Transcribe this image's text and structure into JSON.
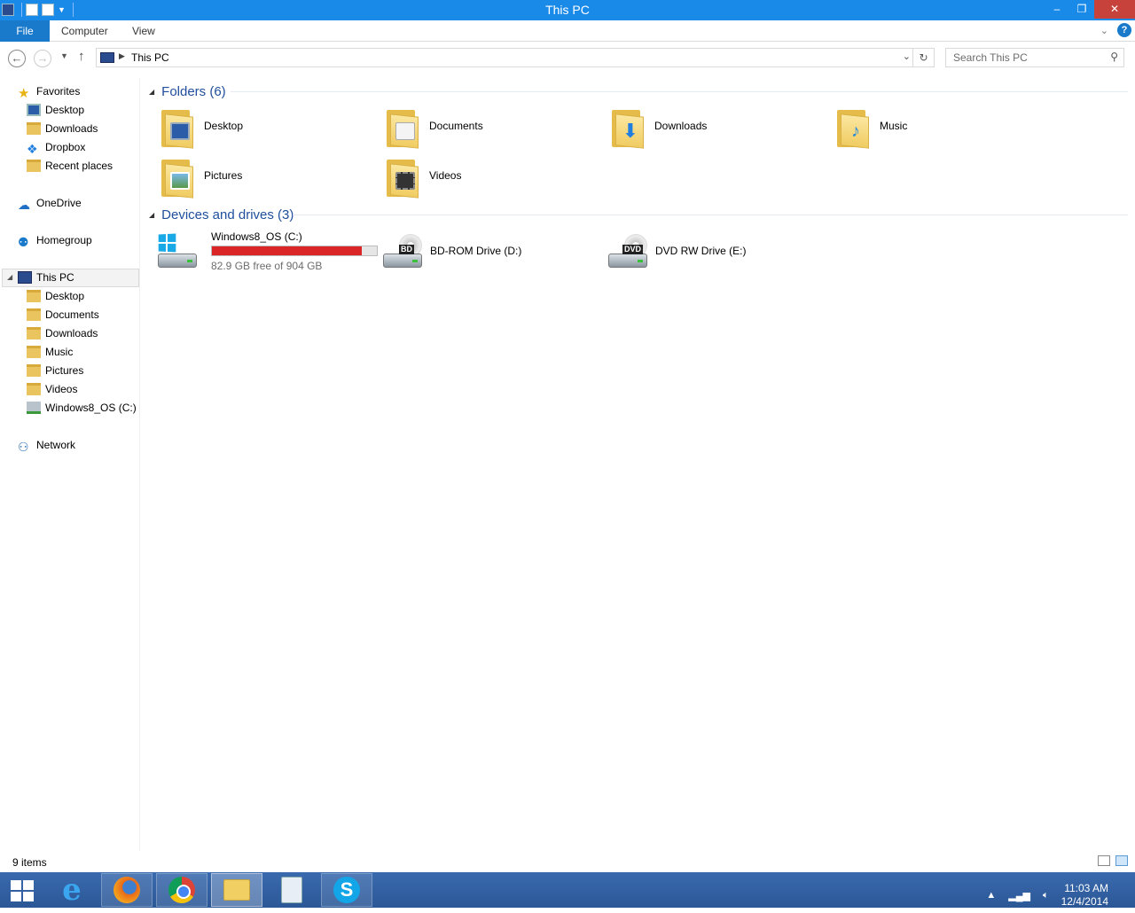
{
  "window": {
    "title": "This PC"
  },
  "ribbon": {
    "file": "File",
    "tabs": [
      "Computer",
      "View"
    ]
  },
  "navigation": {
    "breadcrumb": "This PC",
    "search_placeholder": "Search This PC"
  },
  "sidebar": {
    "favorites": {
      "label": "Favorites",
      "items": [
        "Desktop",
        "Downloads",
        "Dropbox",
        "Recent places"
      ]
    },
    "onedrive": "OneDrive",
    "homegroup": "Homegroup",
    "thispc": {
      "label": "This PC",
      "items": [
        "Desktop",
        "Documents",
        "Downloads",
        "Music",
        "Pictures",
        "Videos",
        "Windows8_OS (C:)"
      ]
    },
    "network": "Network"
  },
  "folders": {
    "header": "Folders (6)",
    "items": [
      "Desktop",
      "Documents",
      "Downloads",
      "Music",
      "Pictures",
      "Videos"
    ]
  },
  "devices": {
    "header": "Devices and drives (3)",
    "drives": [
      {
        "label": "Windows8_OS (C:)",
        "free_text": "82.9 GB free of 904 GB",
        "used_fraction": 0.908
      },
      {
        "label": "BD-ROM Drive (D:)",
        "tag": "BD"
      },
      {
        "label": "DVD RW Drive (E:)",
        "tag": "DVD"
      }
    ]
  },
  "status": {
    "count": "9 items"
  },
  "taskbar": {
    "time": "11:03 AM",
    "date": "12/4/2014"
  },
  "colors": {
    "accent": "#1a8ae8",
    "drive_bar": "#da2626",
    "group_header": "#1f4e9c"
  }
}
